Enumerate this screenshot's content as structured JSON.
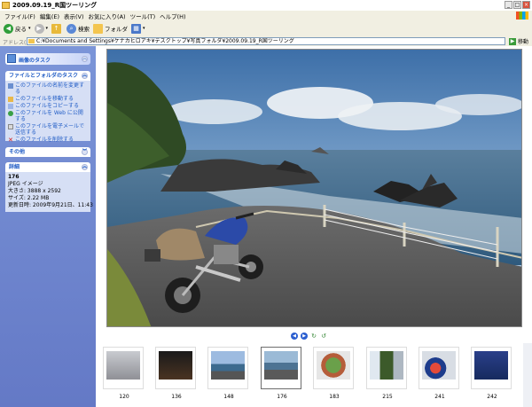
{
  "window": {
    "title": "2009.09.19_R国ツーリング"
  },
  "menu": [
    "ファイル(F)",
    "編集(E)",
    "表示(V)",
    "お気に入り(A)",
    "ツール(T)",
    "ヘルプ(H)"
  ],
  "toolbar": {
    "back": "戻る",
    "search": "検索",
    "folders": "フォルダ"
  },
  "address": {
    "label": "アドレス(D)",
    "path": "C:¥Documents and Settings¥ケナカヒロアキ¥デスクトップ¥写真フォルダ¥2009.09.19_R国ツーリング",
    "go": "移動"
  },
  "sidebar": {
    "image_tasks": {
      "title": "画像のタスク"
    },
    "file_tasks": {
      "title": "ファイルとフォルダのタスク",
      "items": [
        "このファイルの名前を変更する",
        "このファイルを移動する",
        "このファイルをコピーする",
        "このファイルを Web に公開する",
        "このファイルを電子メールで送信する",
        "このファイルを削除する"
      ]
    },
    "other": {
      "title": "その他"
    },
    "details": {
      "title": "詳細",
      "name": "176",
      "type": "JPEG イメージ",
      "size_dims": "大きさ: 3888 x 2592",
      "file_size": "サイズ: 2.22 MB",
      "modified": "更新日時: 2009年9月21日、11:43"
    }
  },
  "filmstrip": {
    "thumbs": [
      {
        "label": "120"
      },
      {
        "label": "136"
      },
      {
        "label": "148"
      },
      {
        "label": "176"
      },
      {
        "label": "183"
      },
      {
        "label": "215"
      },
      {
        "label": "241"
      },
      {
        "label": "242"
      }
    ],
    "selected": "176"
  },
  "colors": {
    "sidebar": "#6e86d0",
    "link": "#215dc6",
    "toolbar": "#f1efe2"
  }
}
